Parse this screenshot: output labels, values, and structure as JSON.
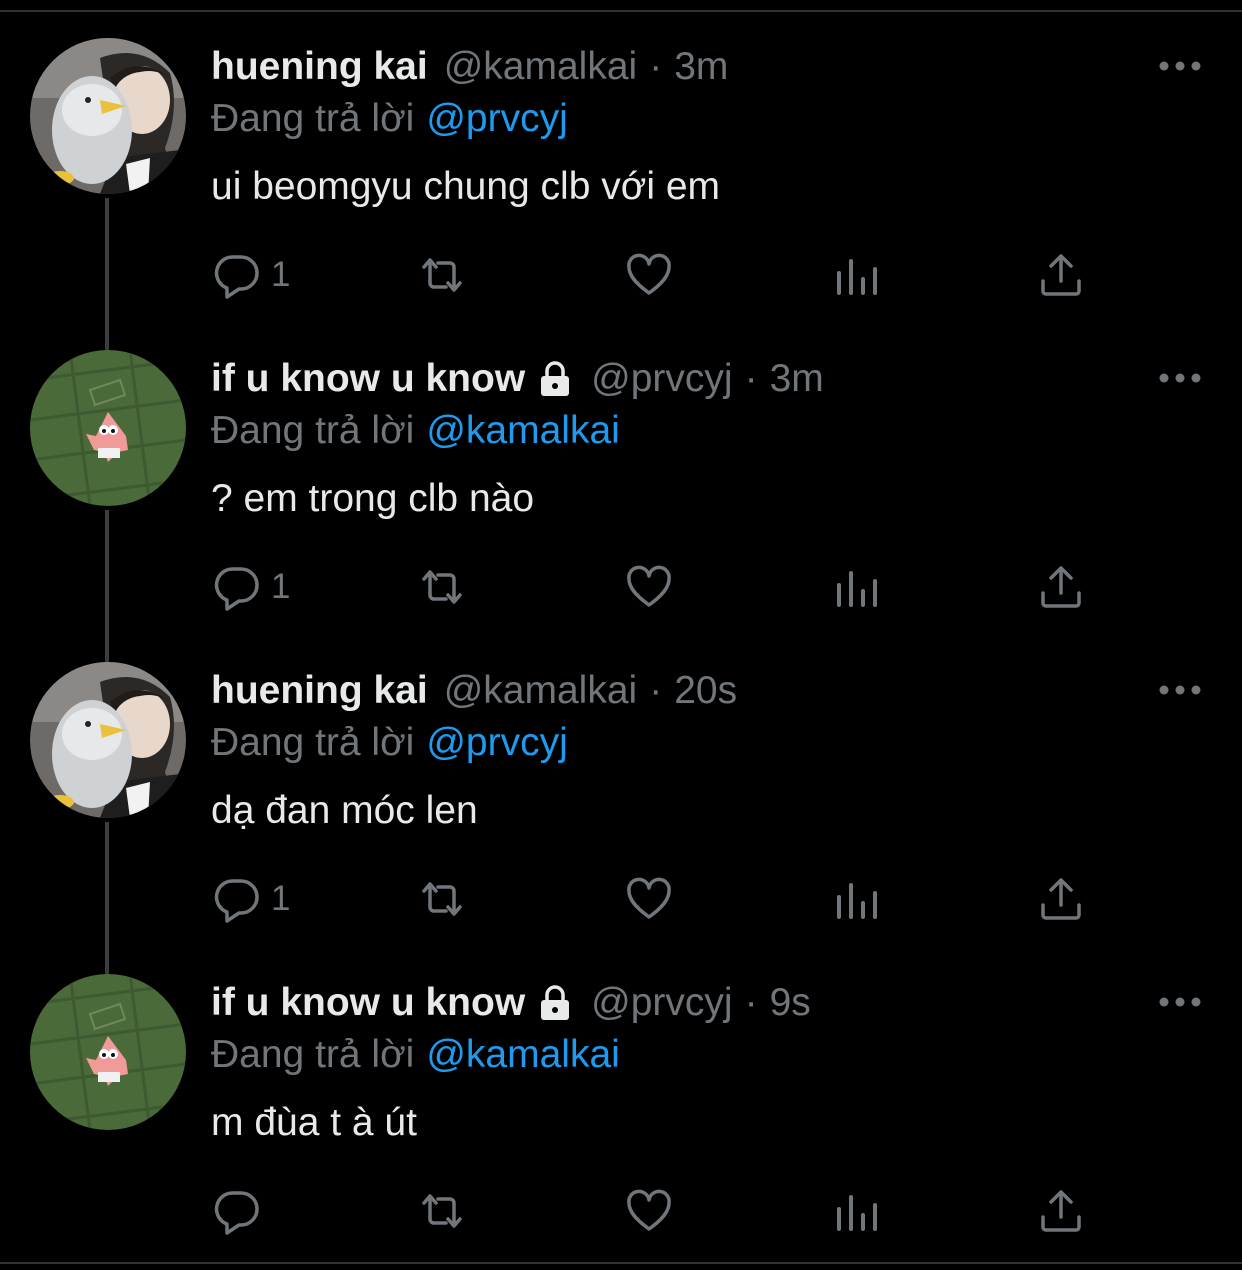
{
  "thread": [
    {
      "author": "huening kai",
      "handle": "@kamalkai",
      "separator": "·",
      "time": "3m",
      "reply_prefix": "Đang trả lời",
      "reply_to": "@prvcyj",
      "text": "ui beomgyu chung clb với em",
      "reply_count": "1",
      "avatar": "avatar-photo-penguin",
      "locked": false
    },
    {
      "author": "if u know u know",
      "handle": "@prvcyj",
      "separator": "·",
      "time": "3m",
      "reply_prefix": "Đang trả lời",
      "reply_to": "@kamalkai",
      "text": "? em trong clb nào",
      "reply_count": "1",
      "avatar": "avatar-patrick-on-grass",
      "locked": true
    },
    {
      "author": "huening kai",
      "handle": "@kamalkai",
      "separator": "·",
      "time": "20s",
      "reply_prefix": "Đang trả lời",
      "reply_to": "@prvcyj",
      "text": "dạ đan móc len",
      "reply_count": "1",
      "avatar": "avatar-photo-penguin",
      "locked": false
    },
    {
      "author": "if u know u know",
      "handle": "@prvcyj",
      "separator": "·",
      "time": "9s",
      "reply_prefix": "Đang trả lời",
      "reply_to": "@kamalkai",
      "text": "m đùa t à út",
      "reply_count": "",
      "avatar": "avatar-patrick-on-grass",
      "locked": true
    }
  ],
  "icons": {
    "reply": "reply-icon",
    "retweet": "retweet-icon",
    "like": "heart-icon",
    "stats": "analytics-icon",
    "share": "share-icon",
    "more": "more-icon",
    "lock": "lock-icon"
  },
  "colors": {
    "background": "#000000",
    "text_primary": "#e7e9ea",
    "text_secondary": "#71767b",
    "accent": "#1d9bf0",
    "thread_line": "#3a3d40"
  }
}
